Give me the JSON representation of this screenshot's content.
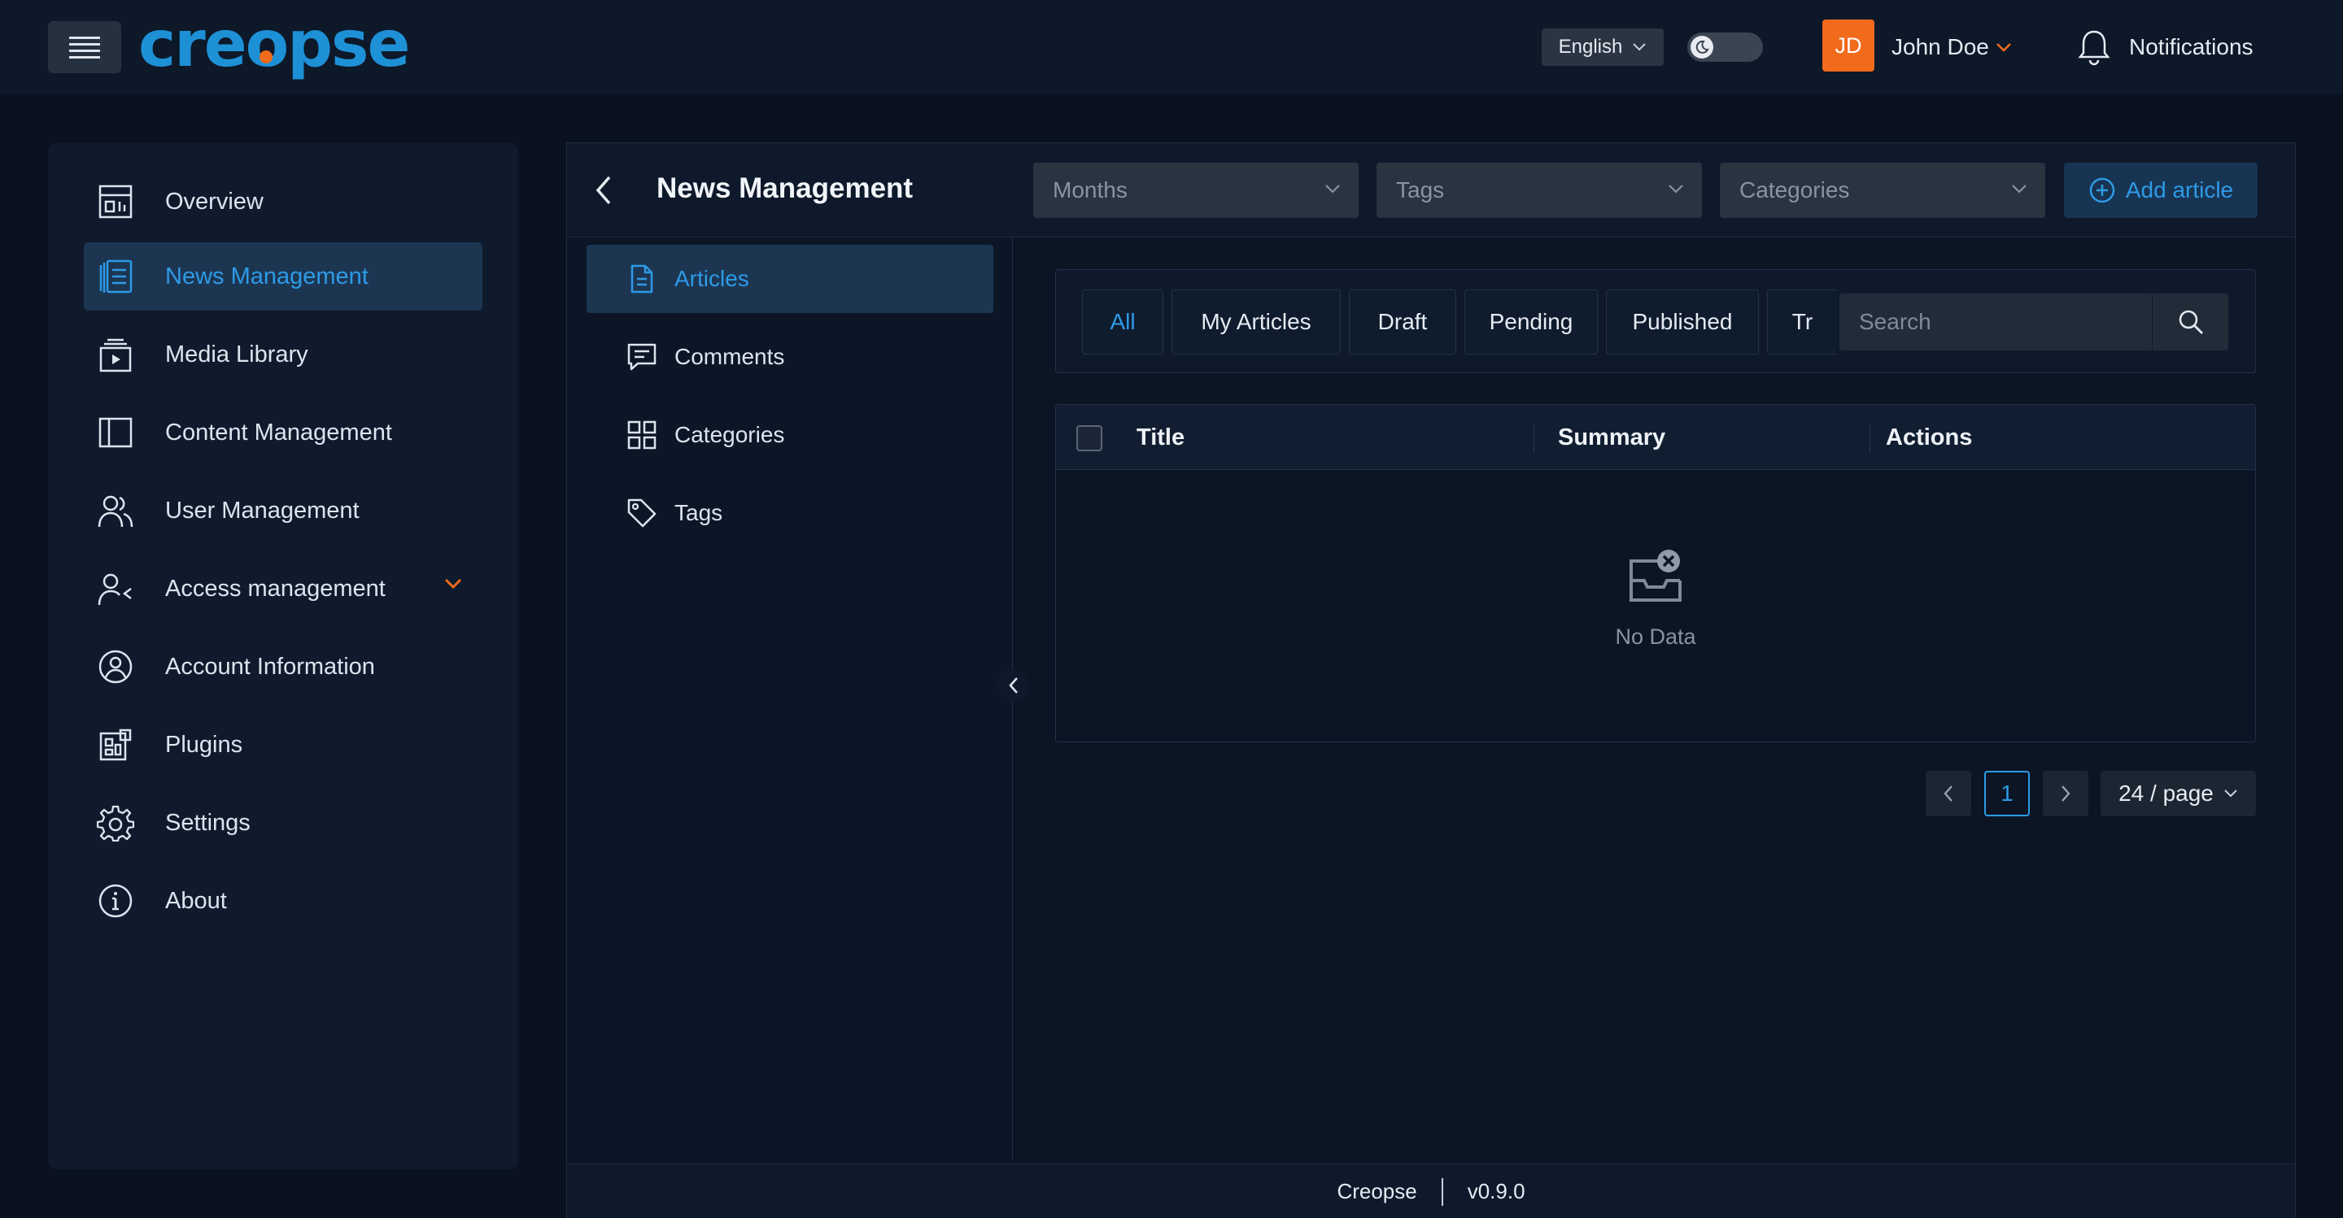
{
  "header": {
    "logo": {
      "before": "cre",
      "o": "o",
      "after": "pse"
    },
    "language": "English",
    "user": {
      "initials": "JD",
      "name": "John Doe"
    },
    "notifications_label": "Notifications"
  },
  "sidebar": {
    "items": [
      {
        "label": "Overview",
        "icon": "overview-icon",
        "active": false
      },
      {
        "label": "News Management",
        "icon": "news-icon",
        "active": true
      },
      {
        "label": "Media Library",
        "icon": "media-icon",
        "active": false
      },
      {
        "label": "Content Management",
        "icon": "content-icon",
        "active": false
      },
      {
        "label": "User Management",
        "icon": "users-icon",
        "active": false
      },
      {
        "label": "Access management",
        "icon": "access-icon",
        "active": false,
        "expandable": true
      },
      {
        "label": "Account Information",
        "icon": "account-icon",
        "active": false
      },
      {
        "label": "Plugins",
        "icon": "plugins-icon",
        "active": false
      },
      {
        "label": "Settings",
        "icon": "gear-icon",
        "active": false
      },
      {
        "label": "About",
        "icon": "info-icon",
        "active": false
      }
    ]
  },
  "main": {
    "title": "News Management",
    "filters": {
      "months_placeholder": "Months",
      "tags_placeholder": "Tags",
      "categories_placeholder": "Categories"
    },
    "add_button": "Add article",
    "subnav": [
      {
        "label": "Articles",
        "icon": "document-icon",
        "active": true
      },
      {
        "label": "Comments",
        "icon": "comment-icon",
        "active": false
      },
      {
        "label": "Categories",
        "icon": "grid-icon",
        "active": false
      },
      {
        "label": "Tags",
        "icon": "tag-icon",
        "active": false
      }
    ],
    "tabs": [
      {
        "label": "All",
        "active": true
      },
      {
        "label": "My Articles",
        "active": false
      },
      {
        "label": "Draft",
        "active": false
      },
      {
        "label": "Pending",
        "active": false
      },
      {
        "label": "Published",
        "active": false
      },
      {
        "label": "Tr",
        "active": false
      }
    ],
    "search_placeholder": "Search",
    "table": {
      "columns": [
        "Title",
        "Summary",
        "Actions"
      ],
      "rows": [],
      "empty_text": "No Data"
    },
    "pagination": {
      "current_page": "1",
      "page_size": "24 / page"
    }
  },
  "footer": {
    "name": "Creopse",
    "version": "v0.9.0"
  },
  "colors": {
    "accent": "#2e9ae6",
    "brand_orange": "#f26a1b",
    "background": "#0a1220",
    "panel": "#0e1a2b"
  }
}
